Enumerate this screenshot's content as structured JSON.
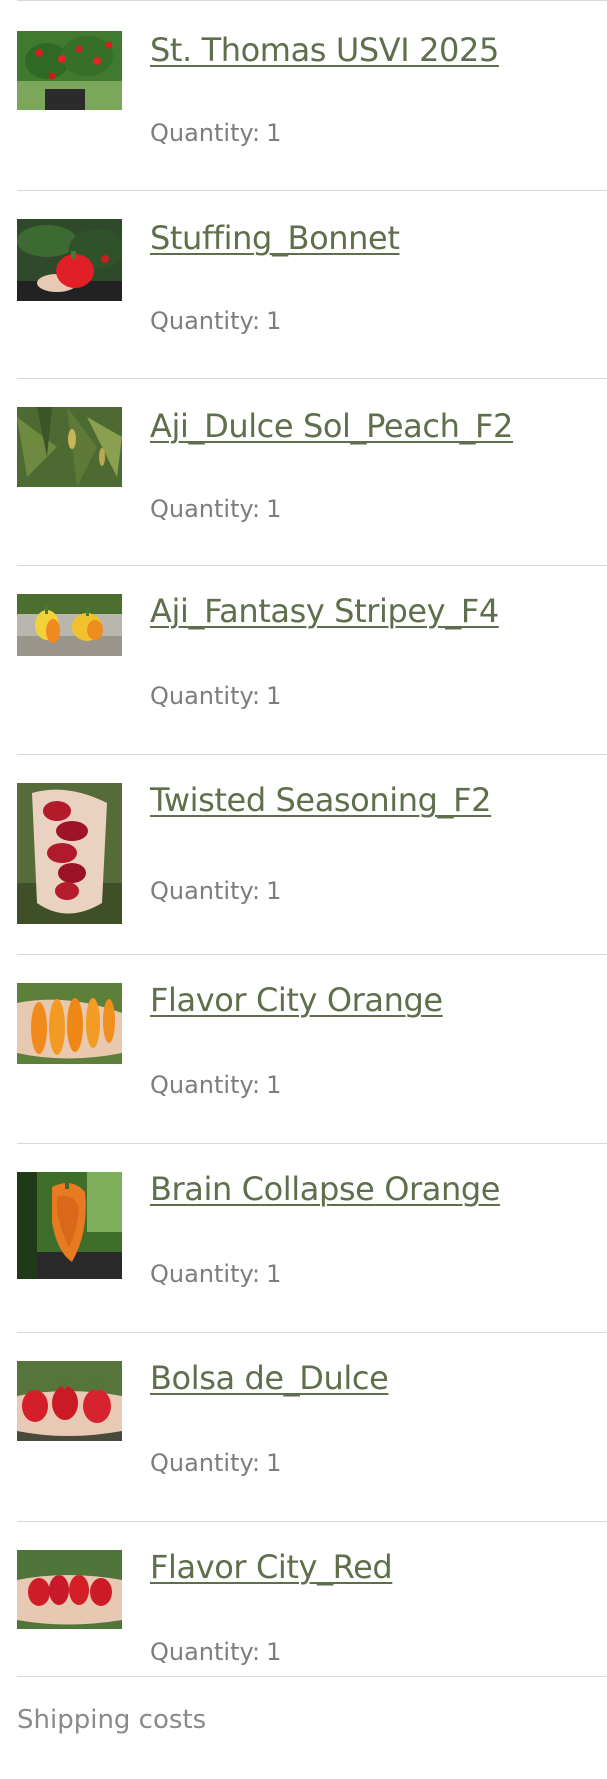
{
  "cart": {
    "quantity_label": "Quantity:",
    "items": [
      {
        "name": "St. Thomas USVI 2025",
        "quantity": "1",
        "image": "pepper-plant-photo"
      },
      {
        "name": "Stuffing_Bonnet",
        "quantity": "1",
        "image": "red-pepper-in-hand-photo"
      },
      {
        "name": "Aji_Dulce Sol_Peach_F2",
        "quantity": "1",
        "image": "pepper-leaves-photo"
      },
      {
        "name": "Aji_Fantasy Stripey_F4",
        "quantity": "1",
        "image": "yellow-orange-peppers-photo"
      },
      {
        "name": "Twisted Seasoning_F2",
        "quantity": "1",
        "image": "red-peppers-in-hand-photo"
      },
      {
        "name": "Flavor City Orange",
        "quantity": "1",
        "image": "orange-peppers-in-hand-photo"
      },
      {
        "name": "Brain Collapse Orange",
        "quantity": "1",
        "image": "orange-pepper-pod-photo"
      },
      {
        "name": "Bolsa de_Dulce",
        "quantity": "1",
        "image": "red-peppers-in-hand-photo"
      },
      {
        "name": "Flavor City_Red",
        "quantity": "1",
        "image": "red-peppers-in-hand-photo"
      }
    ]
  },
  "shipping": {
    "label": "Shipping costs"
  },
  "colors": {
    "link": "#5f6e4b",
    "muted_text": "#7d7d7d",
    "divider": "#d9d9d9"
  }
}
